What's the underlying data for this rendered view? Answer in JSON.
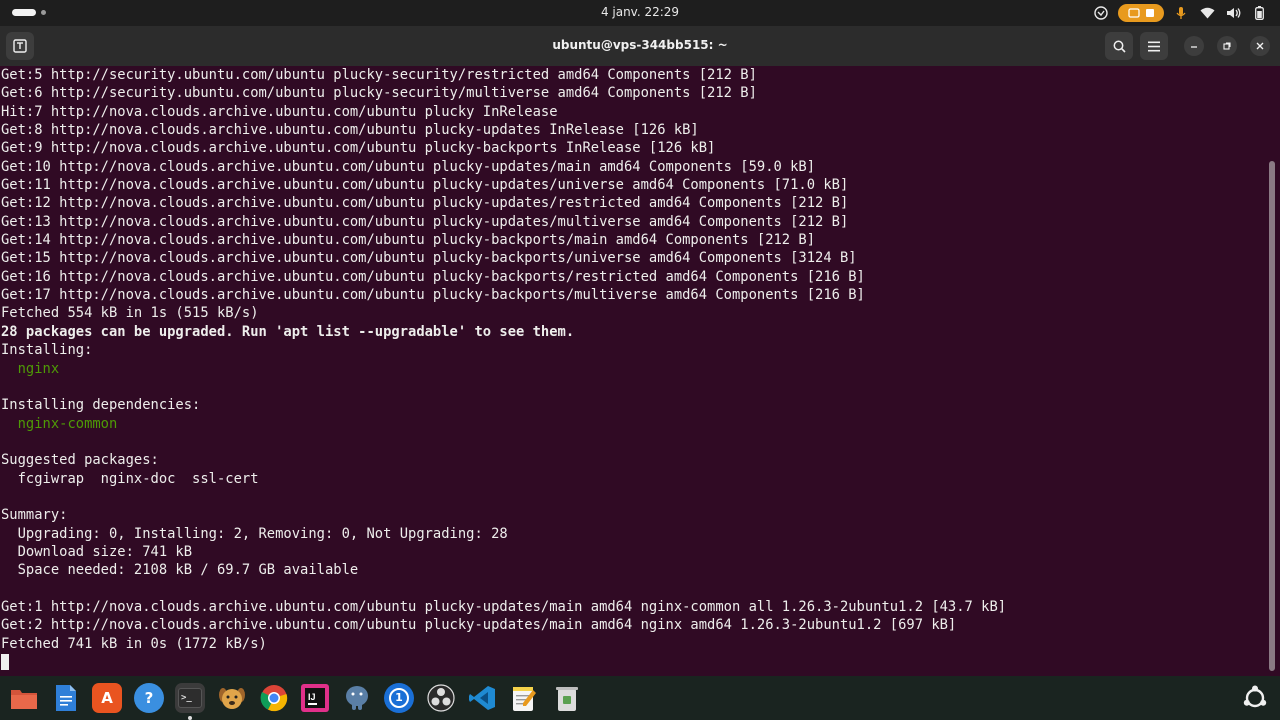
{
  "topbar": {
    "clock": "4 janv.  22:29"
  },
  "window": {
    "title": "ubuntu@vps-344bb515: ~"
  },
  "terminal": {
    "lines": [
      "Get:5 http://security.ubuntu.com/ubuntu plucky-security/restricted amd64 Components [212 B]",
      "Get:6 http://security.ubuntu.com/ubuntu plucky-security/multiverse amd64 Components [212 B]",
      "Hit:7 http://nova.clouds.archive.ubuntu.com/ubuntu plucky InRelease",
      "Get:8 http://nova.clouds.archive.ubuntu.com/ubuntu plucky-updates InRelease [126 kB]",
      "Get:9 http://nova.clouds.archive.ubuntu.com/ubuntu plucky-backports InRelease [126 kB]",
      "Get:10 http://nova.clouds.archive.ubuntu.com/ubuntu plucky-updates/main amd64 Components [59.0 kB]",
      "Get:11 http://nova.clouds.archive.ubuntu.com/ubuntu plucky-updates/universe amd64 Components [71.0 kB]",
      "Get:12 http://nova.clouds.archive.ubuntu.com/ubuntu plucky-updates/restricted amd64 Components [212 B]",
      "Get:13 http://nova.clouds.archive.ubuntu.com/ubuntu plucky-updates/multiverse amd64 Components [212 B]",
      "Get:14 http://nova.clouds.archive.ubuntu.com/ubuntu plucky-backports/main amd64 Components [212 B]",
      "Get:15 http://nova.clouds.archive.ubuntu.com/ubuntu plucky-backports/universe amd64 Components [3124 B]",
      "Get:16 http://nova.clouds.archive.ubuntu.com/ubuntu plucky-backports/restricted amd64 Components [216 B]",
      "Get:17 http://nova.clouds.archive.ubuntu.com/ubuntu plucky-backports/multiverse amd64 Components [216 B]",
      "Fetched 554 kB in 1s (515 kB/s)",
      "28 packages can be upgraded. Run 'apt list --upgradable' to see them.",
      "Installing:",
      "  nginx",
      "",
      "Installing dependencies:",
      "  nginx-common",
      "",
      "Suggested packages:",
      "  fcgiwrap  nginx-doc  ssl-cert",
      "",
      "Summary:",
      "  Upgrading: 0, Installing: 2, Removing: 0, Not Upgrading: 28",
      "  Download size: 741 kB",
      "  Space needed: 2108 kB / 69.7 GB available",
      "",
      "Get:1 http://nova.clouds.archive.ubuntu.com/ubuntu plucky-updates/main amd64 nginx-common all 1.26.3-2ubuntu1.2 [43.7 kB]",
      "Get:2 http://nova.clouds.archive.ubuntu.com/ubuntu plucky-updates/main amd64 nginx amd64 1.26.3-2ubuntu1.2 [697 kB]",
      "Fetched 741 kB in 0s (1772 kB/s)"
    ]
  },
  "dock": {
    "apps": [
      {
        "name": "files",
        "glyph": "",
        "color": "#d4543a"
      },
      {
        "name": "text-document",
        "glyph": "",
        "color": "#2f7fd8"
      },
      {
        "name": "app-center",
        "glyph": "A",
        "color": "#e95420"
      },
      {
        "name": "help",
        "glyph": "?",
        "color": "#3a8fe0"
      },
      {
        "name": "terminal",
        "glyph": ">_",
        "color": "#2d2d2d"
      },
      {
        "name": "dog-app",
        "glyph": "",
        "color": "#d99a3c"
      },
      {
        "name": "chrome",
        "glyph": "",
        "color": "#e0e0e0"
      },
      {
        "name": "intellij",
        "glyph": "IJ",
        "color": "#111111"
      },
      {
        "name": "postgresql",
        "glyph": "",
        "color": "#5a7fa6"
      },
      {
        "name": "password-manager",
        "glyph": "1",
        "color": "#1a6fd6"
      },
      {
        "name": "obs",
        "glyph": "",
        "color": "#2a2a2a"
      },
      {
        "name": "vscode",
        "glyph": "",
        "color": "#1f8ad2"
      },
      {
        "name": "text-editor",
        "glyph": "",
        "color": "#f5d24a"
      },
      {
        "name": "trash",
        "glyph": "",
        "color": "#dcdcdc"
      }
    ]
  },
  "colors": {
    "terminal_bg": "#300a24",
    "package_green": "#4e9a06",
    "accent_orange": "#e89a1e"
  }
}
